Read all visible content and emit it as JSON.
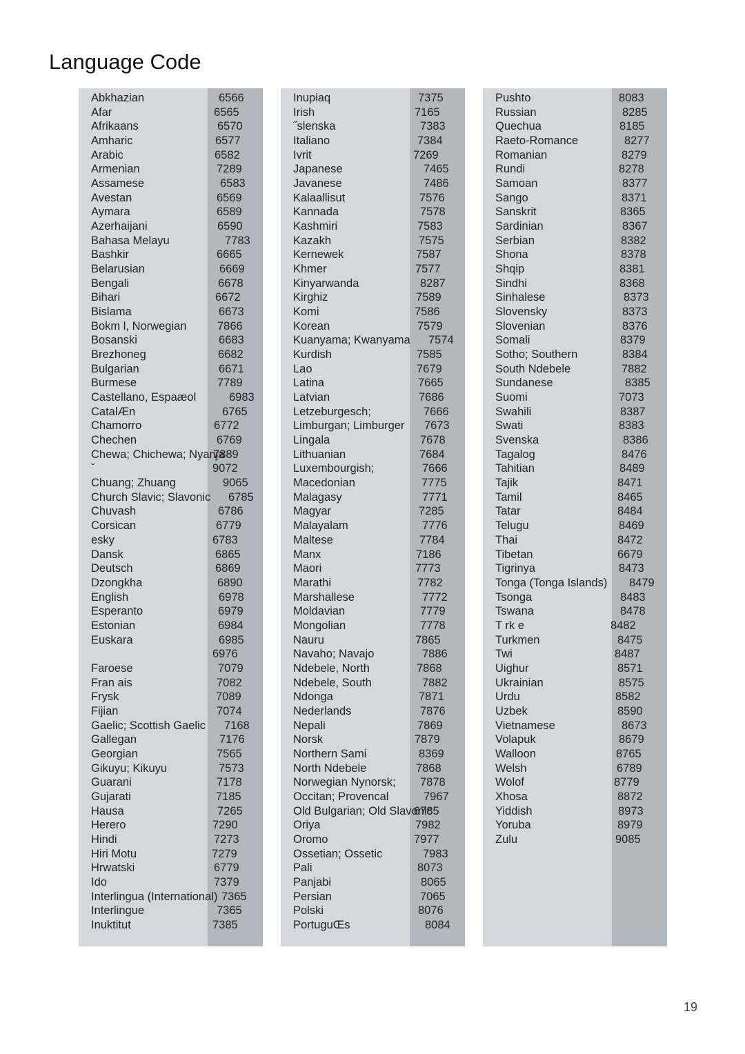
{
  "page": {
    "title": "Language Code",
    "page_number": "19"
  },
  "columns": [
    {
      "rows": [
        {
          "name": "Abkhazian",
          "code": "6566",
          "off": 18
        },
        {
          "name": "Afar",
          "code": "6565",
          "off": 11
        },
        {
          "name": "Afrikaans",
          "code": "6570",
          "off": 16
        },
        {
          "name": "Amharic",
          "code": "6577",
          "off": 13
        },
        {
          "name": "Arabic",
          "code": "6582",
          "off": 12
        },
        {
          "name": "Armenian",
          "code": "7289",
          "off": 15
        },
        {
          "name": "Assamese",
          "code": "6583",
          "off": 20
        },
        {
          "name": "Avestan",
          "code": "6569",
          "off": 15
        },
        {
          "name": "Aymara",
          "code": "6589",
          "off": 15
        },
        {
          "name": "Azerhaijani",
          "code": "6590",
          "off": 16
        },
        {
          "name": "Bahasa Melayu",
          "code": "7783",
          "off": 27
        },
        {
          "name": "Bashkir",
          "code": "6665",
          "off": 15
        },
        {
          "name": "Belarusian",
          "code": "6669",
          "off": 19
        },
        {
          "name": "Bengali",
          "code": "6678",
          "off": 17
        },
        {
          "name": "Bihari",
          "code": "6672",
          "off": 13
        },
        {
          "name": "Bislama",
          "code": "6673",
          "off": 18
        },
        {
          "name": "Bokm l, Norwegian",
          "code": "7866",
          "off": 16
        },
        {
          "name": "Bosanski",
          "code": "6683",
          "off": 18
        },
        {
          "name": "Brezhoneg",
          "code": "6682",
          "off": 17
        },
        {
          "name": "Bulgarian",
          "code": "6671",
          "off": 18
        },
        {
          "name": "Burmese",
          "code": "7789",
          "off": 16
        },
        {
          "name": "Castellano, Espaæol",
          "code": "6983",
          "off": 33
        },
        {
          "name": "CatalÆn",
          "code": "6765",
          "off": 23
        },
        {
          "name": "Chamorro",
          "code": "6772",
          "off": 11
        },
        {
          "name": "Chechen",
          "code": "6769",
          "off": 15
        },
        {
          "name": "Chewa; Chichewa; Nyanja",
          "code": "7889",
          "off": 10
        },
        {
          "name": "ˇ",
          "code": "9072",
          "off": 9
        },
        {
          "name": "Chuang; Zhuang",
          "code": "9065",
          "off": 24
        },
        {
          "name": "Church Slavic; Slavonic",
          "code": "6785",
          "off": 32
        },
        {
          "name": "Chuvash",
          "code": "6786",
          "off": 17
        },
        {
          "name": "Corsican",
          "code": "6779",
          "off": 14
        },
        {
          "name": " esky",
          "code": "6783",
          "off": 9
        },
        {
          "name": "Dansk",
          "code": "6865",
          "off": 13
        },
        {
          "name": "Deutsch",
          "code": "6869",
          "off": 13
        },
        {
          "name": "Dzongkha",
          "code": "6890",
          "off": 16
        },
        {
          "name": "English",
          "code": "6978",
          "off": 18
        },
        {
          "name": "Esperanto",
          "code": "6979",
          "off": 17
        },
        {
          "name": "Estonian",
          "code": "6984",
          "off": 17
        },
        {
          "name": "Euskara",
          "code": "6985",
          "off": 18
        },
        {
          "name": "",
          "code": "6976",
          "off": 9
        },
        {
          "name": "Faroese",
          "code": "7079",
          "off": 17
        },
        {
          "name": "Fran ais",
          "code": "7082",
          "off": 15
        },
        {
          "name": "Frysk",
          "code": "7089",
          "off": 14
        },
        {
          "name": "Fijian",
          "code": "7074",
          "off": 15
        },
        {
          "name": "Gaelic; Scottish Gaelic",
          "code": "7168",
          "off": 26
        },
        {
          "name": "Gallegan",
          "code": "7176",
          "off": 19
        },
        {
          "name": "Georgian",
          "code": "7565",
          "off": 15
        },
        {
          "name": "Gikuyu; Kikuyu",
          "code": "7573",
          "off": 18
        },
        {
          "name": "Guarani",
          "code": "7178",
          "off": 15
        },
        {
          "name": "Gujarati",
          "code": "7185",
          "off": 14
        },
        {
          "name": "Hausa",
          "code": "7265",
          "off": 16
        },
        {
          "name": "Herero",
          "code": "7290",
          "off": 9
        },
        {
          "name": "Hindi",
          "code": "7273",
          "off": 11
        },
        {
          "name": "Hiri Motu",
          "code": "7279",
          "off": 8
        },
        {
          "name": "Hrwatski",
          "code": "6779",
          "off": 11
        },
        {
          "name": "Ido",
          "code": "7379",
          "off": 11
        },
        {
          "name": "Interlingua (International)",
          "code": "7365",
          "off": 22
        },
        {
          "name": "Interlingue",
          "code": "7365",
          "off": 15
        },
        {
          "name": "Inuktitut",
          "code": "7385",
          "off": 9
        }
      ]
    },
    {
      "rows": [
        {
          "name": "Inupiaq",
          "code": "7375",
          "off": 14
        },
        {
          "name": "Irish",
          "code": "7165",
          "off": 9
        },
        {
          "name": "˝slenska",
          "code": "7383",
          "off": 17
        },
        {
          "name": "Italiano",
          "code": "7384",
          "off": 13
        },
        {
          "name": "Ivrit",
          "code": "7269",
          "off": 7
        },
        {
          "name": "Japanese",
          "code": "7465",
          "off": 22
        },
        {
          "name": "Javanese",
          "code": "7486",
          "off": 22
        },
        {
          "name": "Kalaallisut",
          "code": "7576",
          "off": 16
        },
        {
          "name": "Kannada",
          "code": "7578",
          "off": 17
        },
        {
          "name": "Kashmiri",
          "code": "7583",
          "off": 13
        },
        {
          "name": "Kazakh",
          "code": "7575",
          "off": 15
        },
        {
          "name": "Kernewek",
          "code": "7587",
          "off": 11
        },
        {
          "name": "Khmer",
          "code": "7577",
          "off": 10
        },
        {
          "name": "Kinyarwanda",
          "code": "8287",
          "off": 17
        },
        {
          "name": "Kirghiz",
          "code": "7589",
          "off": 11
        },
        {
          "name": "Komi",
          "code": "7586",
          "off": 9
        },
        {
          "name": "Korean",
          "code": "7579",
          "off": 13
        },
        {
          "name": "Kuanyama; Kwanyama",
          "code": "7574",
          "off": 29
        },
        {
          "name": "Kurdish",
          "code": "7585",
          "off": 12
        },
        {
          "name": "Lao",
          "code": "7679",
          "off": 12
        },
        {
          "name": "Latina",
          "code": "7665",
          "off": 14
        },
        {
          "name": "Latvian",
          "code": "7686",
          "off": 15
        },
        {
          "name": "Letzeburgesch;",
          "code": "7666",
          "off": 22
        },
        {
          "name": "Limburgan; Limburger",
          "code": "7673",
          "off": 23
        },
        {
          "name": "Lingala",
          "code": "7678",
          "off": 17
        },
        {
          "name": "Lithuanian",
          "code": "7684",
          "off": 16
        },
        {
          "name": "Luxembourgish;",
          "code": "7666",
          "off": 20
        },
        {
          "name": "Macedonian",
          "code": "7775",
          "off": 19
        },
        {
          "name": "Malagasy",
          "code": "7771",
          "off": 20
        },
        {
          "name": "Magyar",
          "code": "7285",
          "off": 15
        },
        {
          "name": "Malayalam",
          "code": "7776",
          "off": 20
        },
        {
          "name": "Maltese",
          "code": "7784",
          "off": 16
        },
        {
          "name": "Manx",
          "code": "7186",
          "off": 11
        },
        {
          "name": "Maori",
          "code": "7773",
          "off": 10
        },
        {
          "name": "Marathi",
          "code": "7782",
          "off": 13
        },
        {
          "name": "Marshallese",
          "code": "7772",
          "off": 20
        },
        {
          "name": "Moldavian",
          "code": "7779",
          "off": 17
        },
        {
          "name": "Mongolian",
          "code": "7778",
          "off": 17
        },
        {
          "name": "Nauru",
          "code": "7865",
          "off": 10
        },
        {
          "name": "Navaho; Navajo",
          "code": "7886",
          "off": 20
        },
        {
          "name": "Ndebele, North",
          "code": "7868",
          "off": 12
        },
        {
          "name": "Ndebele, South",
          "code": "7882",
          "off": 20
        },
        {
          "name": "Ndonga",
          "code": "7871",
          "off": 15
        },
        {
          "name": "Nederlands",
          "code": "7876",
          "off": 17
        },
        {
          "name": "Nepali",
          "code": "7869",
          "off": 13
        },
        {
          "name": "Norsk",
          "code": "7879",
          "off": 9
        },
        {
          "name": "Northern Sami",
          "code": "8369",
          "off": 15
        },
        {
          "name": "North Ndebele",
          "code": "7868",
          "off": 11
        },
        {
          "name": "Norwegian Nynorsk;",
          "code": "7878",
          "off": 17
        },
        {
          "name": "Occitan; Provencal",
          "code": "7967",
          "off": 22
        },
        {
          "name": "Old Bulgarian; Old Slavonic",
          "code": "6785",
          "off": 8
        },
        {
          "name": "Oriya",
          "code": "7982",
          "off": 10
        },
        {
          "name": "Oromo",
          "code": "7977",
          "off": 8
        },
        {
          "name": "Ossetian; Ossetic",
          "code": "7983",
          "off": 21
        },
        {
          "name": "Pali",
          "code": "8073",
          "off": 13
        },
        {
          "name": "Panjabi",
          "code": "8065",
          "off": 18
        },
        {
          "name": "Persian",
          "code": "7065",
          "off": 17
        },
        {
          "name": "Polski",
          "code": "8076",
          "off": 14
        },
        {
          "name": "PortuguŒs",
          "code": "8084",
          "off": 24
        }
      ]
    },
    {
      "rows": [
        {
          "name": "Pushto",
          "code": "8083",
          "off": 12
        },
        {
          "name": "Russian",
          "code": "8285",
          "off": 17
        },
        {
          "name": "Quechua",
          "code": "8185",
          "off": 13
        },
        {
          "name": "Raeto-Romance",
          "code": "8277",
          "off": 20
        },
        {
          "name": "Romanian",
          "code": "8279",
          "off": 16
        },
        {
          "name": "Rundi",
          "code": "8278",
          "off": 12
        },
        {
          "name": "Samoan",
          "code": "8377",
          "off": 17
        },
        {
          "name": "Sango",
          "code": "8371",
          "off": 16
        },
        {
          "name": "Sanskrit",
          "code": "8365",
          "off": 14
        },
        {
          "name": "Sardinian",
          "code": "8367",
          "off": 17
        },
        {
          "name": "Serbian",
          "code": "8382",
          "off": 15
        },
        {
          "name": "Shona",
          "code": "8378",
          "off": 15
        },
        {
          "name": "Shqip",
          "code": "8381",
          "off": 13
        },
        {
          "name": "Sindhi",
          "code": "8368",
          "off": 13
        },
        {
          "name": "Sinhalese",
          "code": "8373",
          "off": 19
        },
        {
          "name": "Slovensky",
          "code": "8373",
          "off": 17
        },
        {
          "name": "Slovenian",
          "code": "8376",
          "off": 17
        },
        {
          "name": "Somali",
          "code": "8379",
          "off": 14
        },
        {
          "name": "Sotho; Southern",
          "code": "8384",
          "off": 17
        },
        {
          "name": "South Ndebele",
          "code": "7882",
          "off": 16
        },
        {
          "name": "Sundanese",
          "code": "8385",
          "off": 21
        },
        {
          "name": "Suomi",
          "code": "7073",
          "off": 12
        },
        {
          "name": "Swahili",
          "code": "8387",
          "off": 14
        },
        {
          "name": "Swati",
          "code": "8383",
          "off": 12
        },
        {
          "name": "Svenska",
          "code": "8386",
          "off": 18
        },
        {
          "name": "Tagalog",
          "code": "8476",
          "off": 16
        },
        {
          "name": "Tahitian",
          "code": "8489",
          "off": 13
        },
        {
          "name": "Tajik",
          "code": "8471",
          "off": 10
        },
        {
          "name": "Tamil",
          "code": "8465",
          "off": 10
        },
        {
          "name": "Tatar",
          "code": "8484",
          "off": 10
        },
        {
          "name": "Telugu",
          "code": "8469",
          "off": 12
        },
        {
          "name": "Thai",
          "code": "8472",
          "off": 10
        },
        {
          "name": "Tibetan",
          "code": "6679",
          "off": 10
        },
        {
          "name": "Tigrinya",
          "code": "8473",
          "off": 12
        },
        {
          "name": "Tonga (Tonga Islands)",
          "code": "8479",
          "off": 27
        },
        {
          "name": "Tsonga",
          "code": "8483",
          "off": 14
        },
        {
          "name": "Tswana",
          "code": "8478",
          "off": 14
        },
        {
          "name": "T rk e",
          "code": "8482",
          "off": 0
        },
        {
          "name": "Turkmen",
          "code": "8475",
          "off": 10
        },
        {
          "name": "Twi",
          "code": "8487",
          "off": 6
        },
        {
          "name": "Uighur",
          "code": "8571",
          "off": 10
        },
        {
          "name": "Ukrainian",
          "code": "8575",
          "off": 12
        },
        {
          "name": "Urdu",
          "code": "8582",
          "off": 7
        },
        {
          "name": "Uzbek",
          "code": "8590",
          "off": 10
        },
        {
          "name": "Vietnamese",
          "code": "8673",
          "off": 16
        },
        {
          "name": "Volapuk",
          "code": "8679",
          "off": 12
        },
        {
          "name": "Walloon",
          "code": "8765",
          "off": 8
        },
        {
          "name": "Welsh",
          "code": "6789",
          "off": 9
        },
        {
          "name": "Wolof",
          "code": "8779",
          "off": 5
        },
        {
          "name": "Xhosa",
          "code": "8872",
          "off": 10
        },
        {
          "name": "Yiddish",
          "code": "8973",
          "off": 11
        },
        {
          "name": "Yoruba",
          "code": "8979",
          "off": 10
        },
        {
          "name": "Zulu",
          "code": "9085",
          "off": 7
        }
      ]
    }
  ],
  "colors": {
    "panel_bg": "#d4d8dc",
    "code_band_bg": "#b3b8bf",
    "text": "#231f20"
  }
}
